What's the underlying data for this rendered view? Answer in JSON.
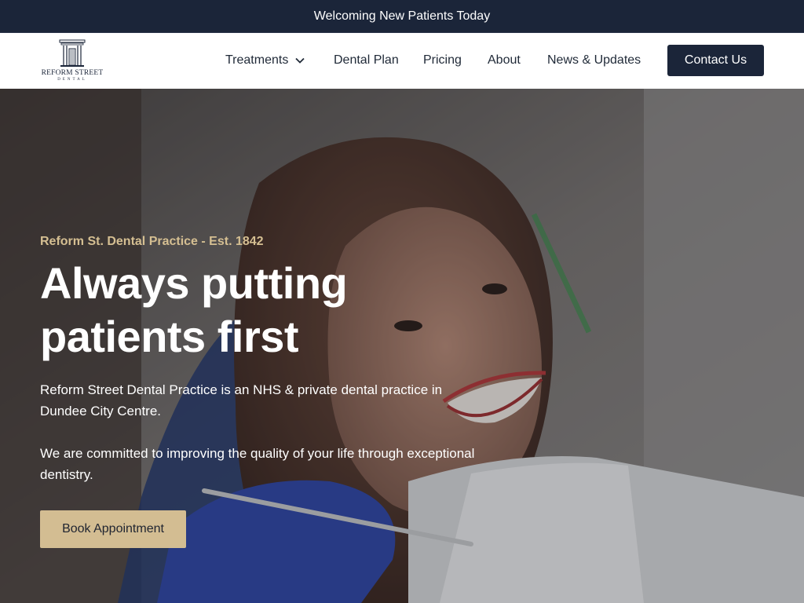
{
  "announcement": "Welcoming New Patients Today",
  "logo": {
    "name": "REFORM STREET",
    "sub": "DENTAL"
  },
  "nav": {
    "items": [
      {
        "label": "Treatments",
        "has_dropdown": true
      },
      {
        "label": "Dental Plan"
      },
      {
        "label": "Pricing"
      },
      {
        "label": "About"
      },
      {
        "label": "News & Updates"
      }
    ],
    "contact_label": "Contact Us"
  },
  "hero": {
    "eyebrow": "Reform St. Dental Practice - Est. 1842",
    "headline": "Always putting patients first",
    "paragraph1": "Reform Street Dental Practice is an NHS & private dental practice in Dundee City Centre.",
    "paragraph2": "We are committed to improving the quality of your life through exceptional dentistry.",
    "cta_label": "Book Appointment"
  },
  "colors": {
    "navy": "#1b2539",
    "gold": "#d3bd92",
    "eyebrow_gold": "#d5bf92"
  },
  "icons": [
    "chevron-down-icon",
    "building-columns-icon"
  ]
}
